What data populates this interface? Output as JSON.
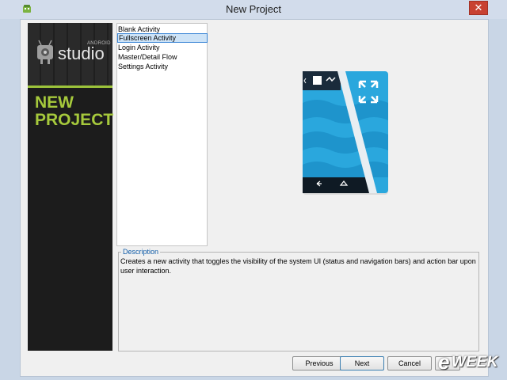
{
  "window": {
    "title": "New Project",
    "close_glyph": "✕"
  },
  "sidebar": {
    "logo_small": "ANDROID",
    "logo_large": "studio",
    "heading_line1": "NEW",
    "heading_line2": "PROJECT"
  },
  "templates": {
    "items": [
      {
        "label": "Blank Activity",
        "selected": false
      },
      {
        "label": "Fullscreen Activity",
        "selected": true
      },
      {
        "label": "Login Activity",
        "selected": false
      },
      {
        "label": "Master/Detail Flow",
        "selected": false
      },
      {
        "label": "Settings Activity",
        "selected": false
      }
    ]
  },
  "description": {
    "legend": "Description",
    "text": "Creates a new activity that toggles the visibility of the system UI (status and navigation bars) and action bar upon user interaction."
  },
  "buttons": {
    "previous": "Previous",
    "next": "Next",
    "cancel": "Cancel",
    "finish": ""
  },
  "watermark": {
    "e": "e",
    "rest": "WEEK"
  },
  "icons": {
    "app": "android-studio-icon",
    "preview": "fullscreen-activity-preview-icon"
  },
  "colors": {
    "accent_green": "#a6c93c",
    "preview_blue": "#2aa7dd",
    "selection_border": "#3b86d5"
  }
}
